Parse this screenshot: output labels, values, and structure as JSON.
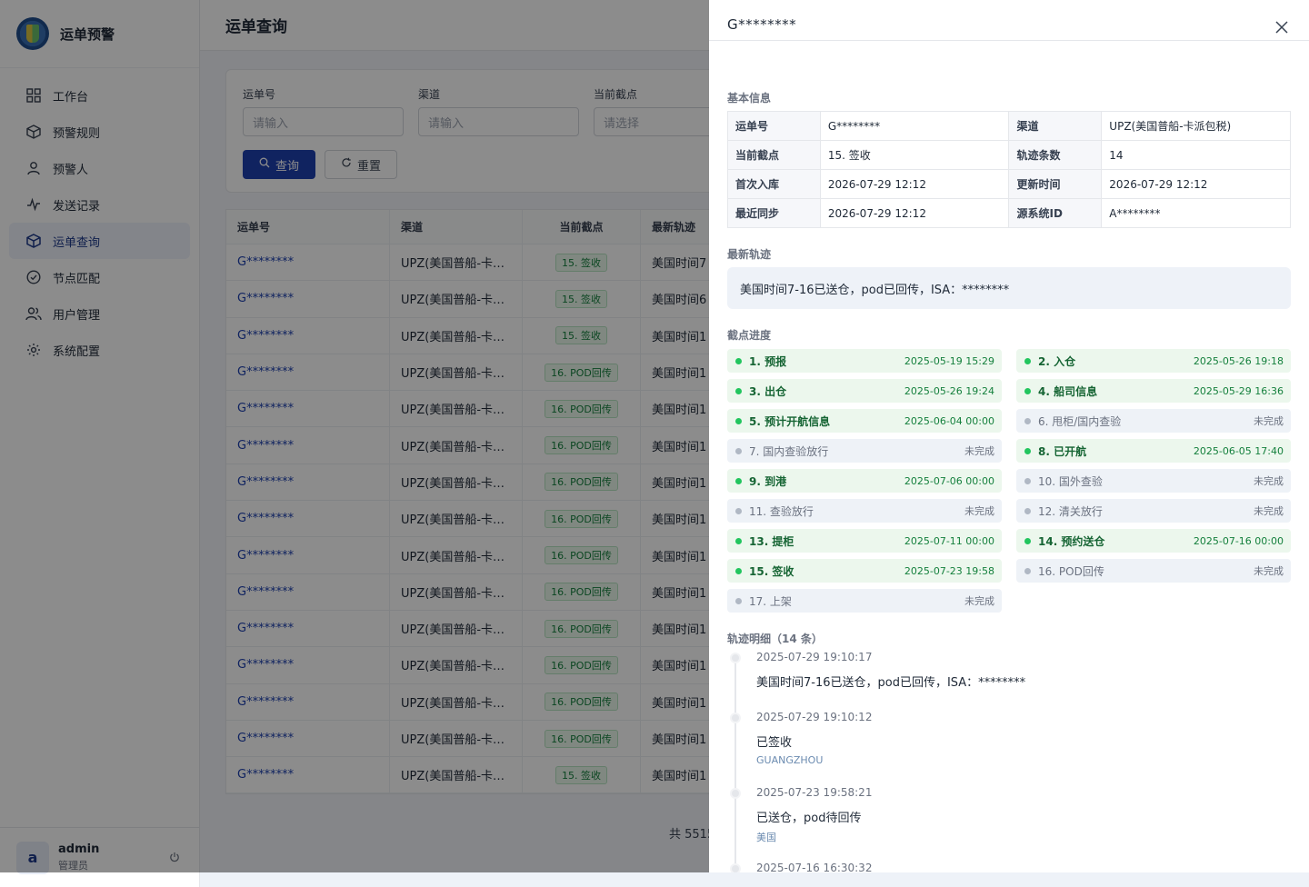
{
  "brand": {
    "name": "运单预警"
  },
  "nav": [
    {
      "label": "工作台",
      "icon": "grid-icon"
    },
    {
      "label": "预警规则",
      "icon": "cube-icon"
    },
    {
      "label": "预警人",
      "icon": "user-icon"
    },
    {
      "label": "发送记录",
      "icon": "activity-icon"
    },
    {
      "label": "运单查询",
      "icon": "package-icon",
      "active": true
    },
    {
      "label": "节点匹配",
      "icon": "check-circle-icon"
    },
    {
      "label": "用户管理",
      "icon": "users-icon"
    },
    {
      "label": "系统配置",
      "icon": "settings-icon"
    }
  ],
  "user": {
    "avatar": "a",
    "name": "admin",
    "role": "管理员"
  },
  "page": {
    "title": "运单查询"
  },
  "filter": {
    "fields": [
      {
        "label": "运单号",
        "placeholder": "请输入"
      },
      {
        "label": "渠道",
        "placeholder": "请输入"
      },
      {
        "label": "当前截点",
        "placeholder": "请选择"
      }
    ],
    "search_label": "查询",
    "reset_label": "重置"
  },
  "table": {
    "headers": [
      "运单号",
      "渠道",
      "当前截点",
      "最新轨迹"
    ],
    "rows": [
      [
        "G********",
        "UPZ(美国普船-卡…",
        "15. 签收",
        "美国时间7"
      ],
      [
        "G********",
        "UPZ(美国普船-卡…",
        "15. 签收",
        "美国时间6"
      ],
      [
        "G********",
        "UPZ(美国普船-卡…",
        "15. 签收",
        "美国时间1"
      ],
      [
        "G********",
        "UPZ(美国普船-卡…",
        "16. POD回传",
        "美国时间1"
      ],
      [
        "G********",
        "UPZ(美国普船-卡…",
        "16. POD回传",
        "美国时间1"
      ],
      [
        "G********",
        "UPZ(美国普船-卡…",
        "16. POD回传",
        "美国时间1"
      ],
      [
        "G********",
        "UPZ(美国普船-卡…",
        "16. POD回传",
        "美国时间1"
      ],
      [
        "G********",
        "UPZ(美国普船-卡…",
        "16. POD回传",
        "美国时间1"
      ],
      [
        "G********",
        "UPZ(美国普船-卡…",
        "16. POD回传",
        "美国时间1"
      ],
      [
        "G********",
        "UPZ(美国普船-卡…",
        "16. POD回传",
        "美国时间1"
      ],
      [
        "G********",
        "UPZ(美国普船-卡…",
        "16. POD回传",
        "美国时间1"
      ],
      [
        "G********",
        "UPZ(美国普船-卡…",
        "16. POD回传",
        "美国时间1"
      ],
      [
        "G********",
        "UPZ(美国普船-卡…",
        "16. POD回传",
        "美国时间1"
      ],
      [
        "G********",
        "UPZ(美国普船-卡…",
        "16. POD回传",
        "美国时间1"
      ],
      [
        "G********",
        "UPZ(美国普船-卡…",
        "15. 签收",
        "美国时间1"
      ]
    ],
    "total_text": "共 5515"
  },
  "drawer": {
    "title": "G********",
    "basic_title": "基本信息",
    "basic": [
      [
        "运单号",
        "G********",
        "渠道",
        "UPZ(美国普船-卡派包税)"
      ],
      [
        "当前截点",
        "15. 签收",
        "轨迹条数",
        "14"
      ],
      [
        "首次入库",
        "2026-07-29 12:12",
        "更新时间",
        "2026-07-29 12:12"
      ],
      [
        "最近同步",
        "2026-07-29 12:12",
        "源系统ID",
        "A********"
      ]
    ],
    "latest_title": "最新轨迹",
    "latest_text": "美国时间7-16已送仓，pod已回传，ISA：********",
    "nodes_title": "截点进度",
    "nodes": [
      {
        "label": "1. 预报",
        "time": "2025-05-19 15:29",
        "done": true
      },
      {
        "label": "2. 入仓",
        "time": "2025-05-26 19:18",
        "done": true
      },
      {
        "label": "3. 出仓",
        "time": "2025-05-26 19:24",
        "done": true
      },
      {
        "label": "4. 船司信息",
        "time": "2025-05-29 16:36",
        "done": true
      },
      {
        "label": "5. 预计开航信息",
        "time": "2025-06-04 00:00",
        "done": true
      },
      {
        "label": "6. 甩柜/国内查验",
        "time": "未完成",
        "done": false
      },
      {
        "label": "7. 国内查验放行",
        "time": "未完成",
        "done": false
      },
      {
        "label": "8. 已开航",
        "time": "2025-06-05 17:40",
        "done": true
      },
      {
        "label": "9. 到港",
        "time": "2025-07-06 00:00",
        "done": true
      },
      {
        "label": "10. 国外查验",
        "time": "未完成",
        "done": false
      },
      {
        "label": "11. 查验放行",
        "time": "未完成",
        "done": false
      },
      {
        "label": "12. 清关放行",
        "time": "未完成",
        "done": false
      },
      {
        "label": "13. 提柜",
        "time": "2025-07-11 00:00",
        "done": true
      },
      {
        "label": "14. 预约送仓",
        "time": "2025-07-16 00:00",
        "done": true
      },
      {
        "label": "15. 签收",
        "time": "2025-07-23 19:58",
        "done": true
      },
      {
        "label": "16. POD回传",
        "time": "未完成",
        "done": false
      },
      {
        "label": "17. 上架",
        "time": "未完成",
        "done": false
      }
    ],
    "timeline_title": "轨迹明细（14 条）",
    "timeline": [
      {
        "time": "2025-07-29 19:10:17",
        "text": "美国时间7-16已送仓，pod已回传，ISA：********",
        "loc": ""
      },
      {
        "time": "2025-07-29 19:10:12",
        "text": "已签收",
        "loc": "GUANGZHOU"
      },
      {
        "time": "2025-07-23 19:58:21",
        "text": "已送仓，pod待回传",
        "loc": "美国"
      },
      {
        "time": "2025-07-16 16:30:32",
        "text": "",
        "loc": ""
      }
    ]
  }
}
